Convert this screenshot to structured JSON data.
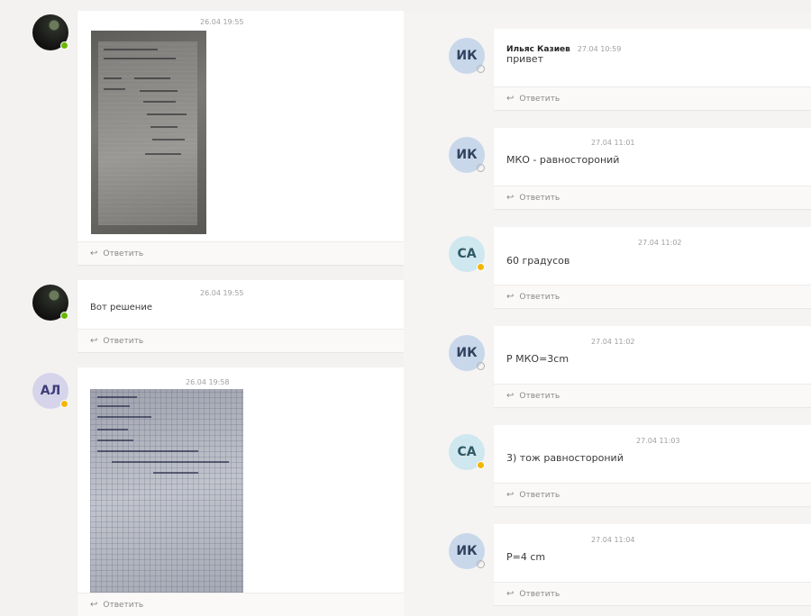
{
  "left": {
    "messages": [
      {
        "avatar": "",
        "status": "green",
        "timestamp": "26.04 19:55",
        "text": "",
        "has_image": true,
        "reply": "Ответить"
      },
      {
        "avatar": "",
        "status": "green",
        "timestamp": "26.04 19:55",
        "text": "Вот решение",
        "has_image": false,
        "reply": "Ответить"
      },
      {
        "avatar": "АЛ",
        "status": "yellow",
        "timestamp": "26.04 19:58",
        "text": "",
        "has_image": true,
        "reply": "Ответить"
      }
    ]
  },
  "right": {
    "messages": [
      {
        "avatar": "ИК",
        "status": "grey",
        "author": "Ильяс Казиев",
        "timestamp": "27.04 10:59",
        "text": "привет",
        "reply": "Ответить"
      },
      {
        "avatar": "ИК",
        "status": "grey",
        "author": "",
        "timestamp": "27.04 11:01",
        "text": "МКО - равностороний",
        "reply": "Ответить"
      },
      {
        "avatar": "СА",
        "status": "yellow",
        "author": "",
        "timestamp": "27.04 11:02",
        "text": "60 градусов",
        "reply": "Ответить"
      },
      {
        "avatar": "ИК",
        "status": "grey",
        "author": "",
        "timestamp": "27.04 11:02",
        "text": "P МКО=3cm",
        "reply": "Ответить"
      },
      {
        "avatar": "СА",
        "status": "yellow",
        "author": "",
        "timestamp": "27.04 11:03",
        "text": "3) тож равностороний",
        "reply": "Ответить"
      },
      {
        "avatar": "ИК",
        "status": "grey",
        "author": "",
        "timestamp": "27.04 11:04",
        "text": "P=4 cm",
        "reply": "Ответить"
      }
    ]
  },
  "icons": {
    "reply": "reply-arrow-icon",
    "status_available": "green",
    "status_away": "yellow",
    "status_offline": "grey"
  },
  "colors": {
    "background": "#f3f2f1",
    "card": "#ffffff",
    "reply_bar": "#faf9f8",
    "available": "#6bb700",
    "away": "#f2b705"
  }
}
